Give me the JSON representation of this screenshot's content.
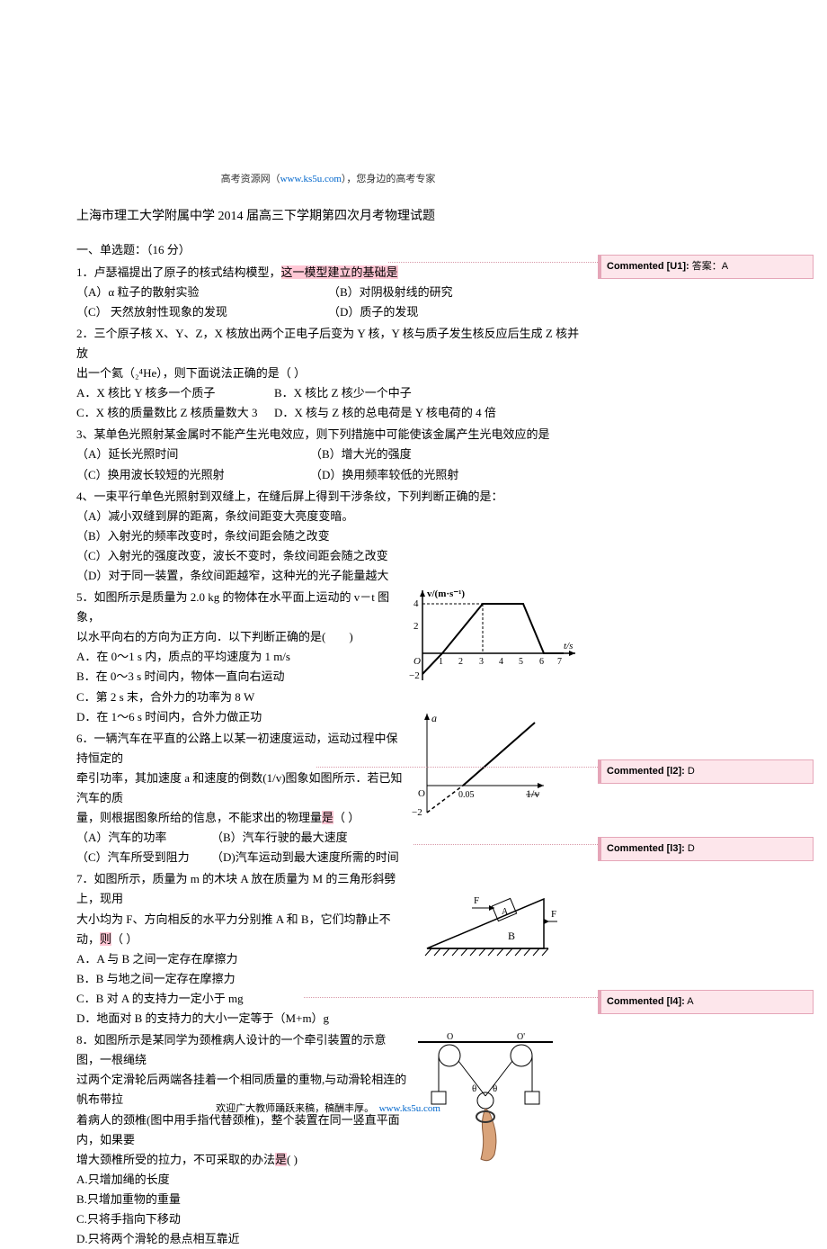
{
  "header": {
    "site": "高考资源网（",
    "url": "www.ks5u.com",
    "suffix": "），您身边的高考专家"
  },
  "title": "上海市理工大学附属中学 2014 届高三下学期第四次月考物理试题",
  "section1": "一、单选题：（16 分）",
  "q1": {
    "stem": "1．卢瑟福提出了原子的核式结构模型，",
    "hl": "这一模型建立的基础是",
    "opts": {
      "A": "（A）α 粒子的散射实验",
      "B": "（B）对阴极射线的研究",
      "C": "（C）  天然放射性现象的发现",
      "D": "（D）质子的发现"
    }
  },
  "q2": {
    "l1a": "2．三个原子核 X、Y、Z，X 核放出两个正电子后变为 Y 核，Y 核与质子发生核反应后生成 Z 核并放",
    "l1b_pre": "出一个氦（",
    "l1b_he": "₂⁴He",
    "l1b_post": "），则下面说法正确的是（    ）",
    "opts": {
      "A": "A．X 核比 Y 核多一个质子",
      "B": "B．X 核比 Z 核少一个中子",
      "C": "C．X 核的质量数比 Z 核质量数大 3",
      "D": "D．X 核与 Z 核的总电荷是 Y 核电荷的 4 倍"
    }
  },
  "q3": {
    "stem": "3、某单色光照射某金属时不能产生光电效应，则下列措施中可能使该金属产生光电效应的是",
    "opts": {
      "A": "（A）延长光照时间",
      "B": "（B）增大光的强度",
      "C": "（C）换用波长较短的光照射",
      "D": "（D）换用频率较低的光照射"
    }
  },
  "q4": {
    "stem": "4、一束平行单色光照射到双缝上，在缝后屏上得到干涉条纹，下列判断正确的是：",
    "opts": {
      "A": "（A）减小双缝到屏的距离，条纹间距变大亮度变暗。",
      "B": "（B）入射光的频率改变时，条纹间距会随之改变",
      "C": "（C）入射光的强度改变，波长不变时，条纹间距会随之改变",
      "D": "（D）对于同一装置，条纹间距越窄，这种光的光子能量越大"
    }
  },
  "q5": {
    "l1": "5．如图所示是质量为 2.0 kg 的物体在水平面上运动的 v－t 图象，",
    "l2": "以水平向右的方向为正方向．以下判断正确的是(　　)",
    "opts": {
      "A": "A．在 0～1 s 内，质点的平均速度为 1 m/s",
      "B": "B．在 0～3 s 时间内，物体一直向右运动",
      "C": "C．第 2 s 末，合外力的功率为 8 W",
      "D": "D．在 1～6 s 时间内，合外力做正功"
    }
  },
  "q6": {
    "l1": "6．一辆汽车在平直的公路上以某一初速度运动，运动过程中保持恒定的",
    "l2": "牵引功率，其加速度 a 和速度的倒数(1/v)图象如图所示．若已知汽车的质",
    "l3": "量，则根据图象所给的信息，不能求出的物理量",
    "hl": "是",
    "l3b": "（    ）",
    "opts": {
      "A": "（A）汽车的功率",
      "B": "（B）汽车行驶的最大速度",
      "C": "（C）汽车所受到阻力",
      "D": "（D)汽车运动到最大速度所需的时间"
    }
  },
  "q7": {
    "l1": "7．如图所示，质量为 m 的木块 A 放在质量为 M 的三角形斜劈上，现用",
    "l2": "大小均为 F、方向相反的水平力分别推 A 和 B，它们均静止不动，",
    "hl": "则",
    "l2b": "（  ）",
    "opts": {
      "A": "A．A 与 B 之间一定存在摩擦力",
      "B": "B．B 与地之间一定存在摩擦力",
      "C": "C．B 对 A 的支持力一定小于 mg",
      "D": "D．地面对 B 的支持力的大小一定等于（M+m）g"
    }
  },
  "q8": {
    "l1": "8．如图所示是某同学为颈椎病人设计的一个牵引装置的示意图，一根绳绕",
    "l2": "过两个定滑轮后两端各挂着一个相同质量的重物,与动滑轮相连的帆布带拉",
    "l3": "着病人的颈椎(图中用手指代替颈椎)，整个装置在同一竖直平面内，如果要",
    "l4a": "增大颈椎所受的拉力，不可采取的办法",
    "hl": "是",
    "l4b": "(     )",
    "opts": {
      "A": "A.只增加绳的长度",
      "B": "B.只增加重物的重量",
      "C": "C.只将手指向下移动",
      "D": "D.只将两个滑轮的悬点相互靠近"
    }
  },
  "footer": {
    "pre": "欢迎广大教师踊跃来稿，稿酬丰厚。",
    "url": "www.ks5u.com"
  },
  "comments": {
    "c1": {
      "lbl": "Commented [U1]:",
      "txt": " 答案：A"
    },
    "c2": {
      "lbl": "Commented [l2]:",
      "txt": " D"
    },
    "c3": {
      "lbl": "Commented [l3]:",
      "txt": " D"
    },
    "c4": {
      "lbl": "Commented [l4]:",
      "txt": " A"
    }
  },
  "chart_data": [
    {
      "type": "line",
      "note": "Q5 v-t graph",
      "xlabel": "t/s",
      "ylabel": "v/(m·s⁻¹)",
      "x": [
        0,
        1,
        3,
        5,
        6,
        7
      ],
      "y": [
        -2,
        0,
        4,
        4,
        0,
        0
      ],
      "ylim": [
        -2,
        4
      ]
    },
    {
      "type": "line",
      "note": "Q6 a vs 1/v graph (linear)",
      "xlabel": "1/v",
      "ylabel": "a",
      "x_intercept_dashed": 0.05,
      "y_intercept": -2,
      "slope_positive": true
    }
  ]
}
